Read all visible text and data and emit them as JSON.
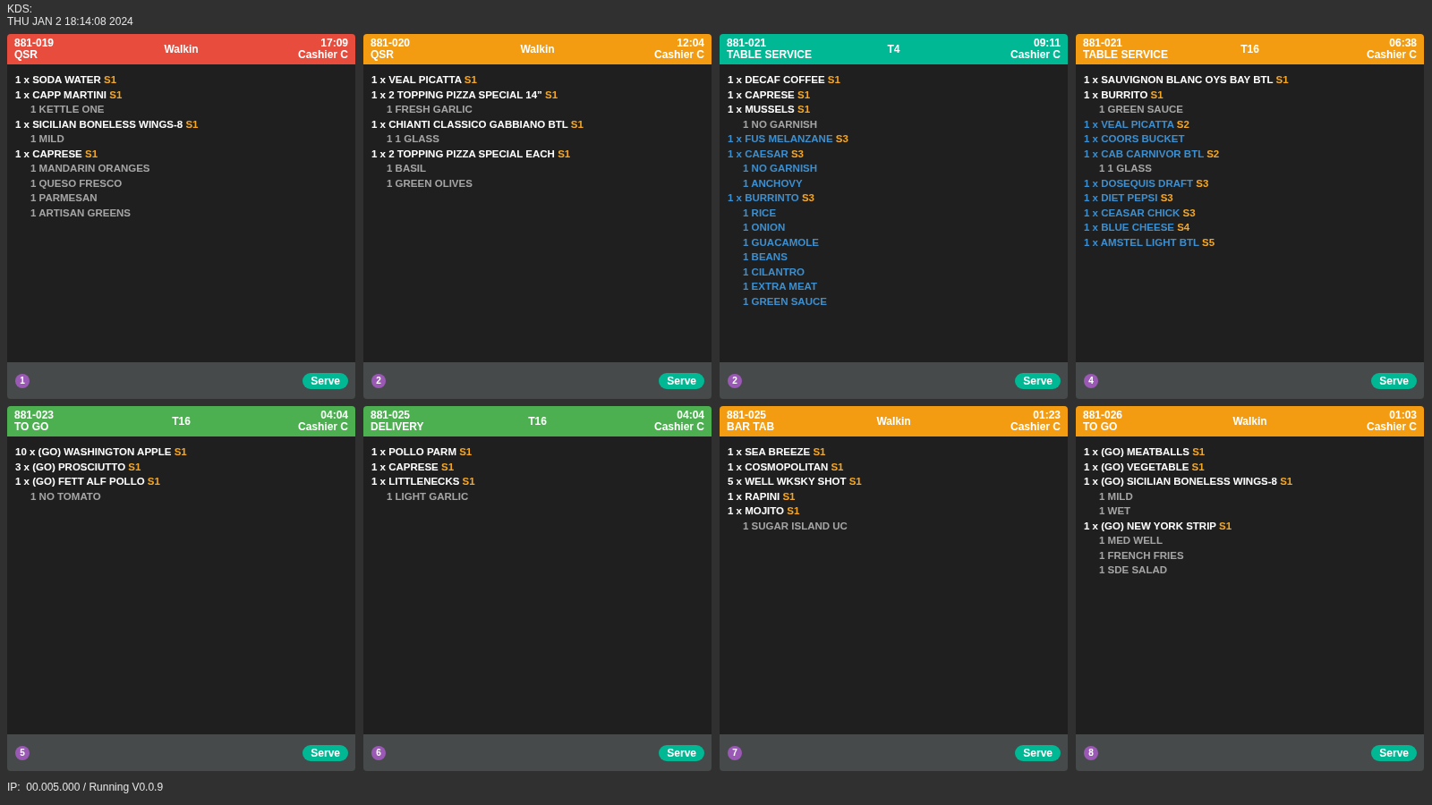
{
  "header": {
    "title": "KDS:",
    "datetime": "THU JAN 2 18:14:08 2024"
  },
  "orders": [
    {
      "number": "881-019",
      "order_type": "QSR",
      "table": "Walkin",
      "time": "17:09",
      "cashier": "Cashier C",
      "color": "#e84c3d",
      "items": [
        {
          "text": "1 x SODA WATER",
          "seat": "S1",
          "color": "#ffffff"
        },
        {
          "text": "1 x CAPP MARTINI",
          "seat": "S1",
          "color": "#ffffff",
          "children": [
            {
              "text": "1 KETTLE ONE",
              "color": "#a5a5a5"
            }
          ]
        },
        {
          "text": "1 x SICILIAN BONELESS WINGS-8",
          "seat": "S1",
          "color": "#ffffff",
          "children": [
            {
              "text": "1 MILD",
              "color": "#a5a5a5"
            }
          ]
        },
        {
          "text": "1 x CAPRESE",
          "seat": "S1",
          "color": "#ffffff",
          "children": [
            {
              "text": "1 MANDARIN ORANGES",
              "color": "#a5a5a5"
            },
            {
              "text": "1 QUESO FRESCO",
              "color": "#a5a5a5"
            },
            {
              "text": "1 PARMESAN",
              "color": "#a5a5a5"
            },
            {
              "text": "1 ARTISAN GREENS",
              "color": "#a5a5a5"
            }
          ]
        }
      ],
      "badge": "1",
      "action": "Serve"
    },
    {
      "number": "881-020",
      "order_type": "QSR",
      "table": "Walkin",
      "time": "12:04",
      "cashier": "Cashier C",
      "color": "#f39c12",
      "items": [
        {
          "text": "1 x VEAL PICATTA",
          "seat": "S1",
          "color": "#ffffff"
        },
        {
          "text": "1 x 2 TOPPING PIZZA SPECIAL 14”",
          "seat": "S1",
          "color": "#ffffff",
          "children": [
            {
              "text": "1 FRESH GARLIC",
              "color": "#a5a5a5"
            }
          ]
        },
        {
          "text": "1 x CHIANTI CLASSICO GABBIANO BTL",
          "seat": "S1",
          "color": "#ffffff",
          "children": [
            {
              "text": "1 1 GLASS",
              "color": "#a5a5a5"
            }
          ]
        },
        {
          "text": "1 x 2 TOPPING PIZZA SPECIAL EACH",
          "seat": "S1",
          "color": "#ffffff",
          "children": [
            {
              "text": "1 BASIL",
              "color": "#a5a5a5"
            },
            {
              "text": "1 GREEN OLIVES",
              "color": "#a5a5a5"
            }
          ]
        }
      ],
      "badge": "2",
      "action": "Serve"
    },
    {
      "number": "881-021",
      "order_type": "TABLE SERVICE",
      "table": "T4",
      "time": "09:11",
      "cashier": "Cashier C",
      "color": "#00b894",
      "items": [
        {
          "text": "1 x DECAF COFFEE",
          "seat": "S1",
          "color": "#ffffff"
        },
        {
          "text": "1 x CAPRESE",
          "seat": "S1",
          "color": "#ffffff"
        },
        {
          "text": "1 x MUSSELS",
          "seat": "S1",
          "color": "#ffffff",
          "children": [
            {
              "text": "1 NO GARNISH",
              "color": "#a5a5a5"
            }
          ]
        },
        {
          "text": "1 x FUS MELANZANE",
          "seat": "S3",
          "color": "#3c8fd0"
        },
        {
          "text": "1 x CAESAR",
          "seat": "S3",
          "color": "#3c8fd0",
          "children": [
            {
              "text": "1 NO GARNISH",
              "color": "#3c8fd0"
            },
            {
              "text": "1 ANCHOVY",
              "color": "#3c8fd0"
            }
          ]
        },
        {
          "text": "1 x BURRINTO",
          "seat": "S3",
          "color": "#3c8fd0",
          "children": [
            {
              "text": "1 RICE",
              "color": "#3c8fd0"
            },
            {
              "text": "1 ONION",
              "color": "#3c8fd0"
            },
            {
              "text": "1 GUACAMOLE",
              "color": "#3c8fd0"
            },
            {
              "text": "1 BEANS",
              "color": "#3c8fd0"
            },
            {
              "text": "1 CILANTRO",
              "color": "#3c8fd0"
            },
            {
              "text": "1 EXTRA MEAT",
              "color": "#3c8fd0"
            },
            {
              "text": "1 GREEN SAUCE",
              "color": "#3c8fd0"
            }
          ]
        }
      ],
      "badge": "2",
      "action": "Serve"
    },
    {
      "number": "881-021",
      "order_type": "TABLE SERVICE",
      "table": "T16",
      "time": "06:38",
      "cashier": "Cashier C",
      "color": "#f39c12",
      "items": [
        {
          "text": "1 x SAUVIGNON BLANC OYS BAY BTL",
          "seat": "S1",
          "color": "#ffffff"
        },
        {
          "text": "1 x BURRITO",
          "seat": "S1",
          "color": "#ffffff",
          "children": [
            {
              "text": "1 GREEN SAUCE",
              "color": "#a5a5a5"
            }
          ]
        },
        {
          "text": "1 x VEAL PICATTA",
          "seat": "S2",
          "color": "#3c8fd0"
        },
        {
          "text": "1 x COORS BUCKET",
          "color": "#3c8fd0"
        },
        {
          "text": "1 x CAB CARNIVOR BTL",
          "seat": "S2",
          "color": "#3c8fd0",
          "children": [
            {
              "text": "1 1 GLASS",
              "color": "#a5a5a5"
            }
          ]
        },
        {
          "text": "1 x DOSEQUIS DRAFT",
          "seat": "S3",
          "color": "#3c8fd0"
        },
        {
          "text": "1 x DIET PEPSI",
          "seat": "S3",
          "color": "#3c8fd0"
        },
        {
          "text": "1 x CEASAR CHICK",
          "seat": "S3",
          "color": "#3c8fd0"
        },
        {
          "text": "1 x BLUE CHEESE",
          "seat": "S4",
          "color": "#3c8fd0"
        },
        {
          "text": "1 x AMSTEL LIGHT BTL",
          "seat": "S5",
          "color": "#3c8fd0"
        }
      ],
      "badge": "4",
      "action": "Serve"
    },
    {
      "number": "881-023",
      "order_type": "TO GO",
      "table": "T16",
      "time": "04:04",
      "cashier": "Cashier C",
      "color": "#4caf50",
      "items": [
        {
          "text": "10 x (GO) WASHINGTON APPLE",
          "seat": "S1",
          "color": "#ffffff"
        },
        {
          "text": "3 x (GO) PROSCIUTTO",
          "seat": "S1",
          "color": "#ffffff"
        },
        {
          "text": "1 x (GO) FETT ALF POLLO",
          "seat": "S1",
          "color": "#ffffff",
          "children": [
            {
              "text": "1 NO TOMATO",
              "color": "#a5a5a5"
            }
          ]
        }
      ],
      "badge": "5",
      "action": "Serve"
    },
    {
      "number": "881-025",
      "order_type": "DELIVERY",
      "table": "T16",
      "time": "04:04",
      "cashier": "Cashier C",
      "color": "#4caf50",
      "items": [
        {
          "text": "1 x POLLO PARM",
          "seat": "S1",
          "color": "#ffffff"
        },
        {
          "text": "1 x CAPRESE",
          "seat": "S1",
          "color": "#ffffff"
        },
        {
          "text": "1 x LITTLENECKS",
          "seat": "S1",
          "color": "#ffffff",
          "children": [
            {
              "text": "1 LIGHT GARLIC",
              "color": "#a5a5a5"
            }
          ]
        }
      ],
      "badge": "6",
      "action": "Serve"
    },
    {
      "number": "881-025",
      "order_type": "BAR TAB",
      "table": "Walkin",
      "time": "01:23",
      "cashier": "Cashier C",
      "color": "#f39c12",
      "items": [
        {
          "text": "1 x SEA BREEZE",
          "seat": "S1",
          "color": "#ffffff"
        },
        {
          "text": "1 x COSMOPOLITAN",
          "seat": "S1",
          "color": "#ffffff"
        },
        {
          "text": "5 x WELL WKSKY SHOT",
          "seat": "S1",
          "color": "#ffffff"
        },
        {
          "text": "1 x RAPINI",
          "seat": "S1",
          "color": "#ffffff"
        },
        {
          "text": "1 x MOJITO",
          "seat": "S1",
          "color": "#ffffff",
          "children": [
            {
              "text": "1 SUGAR ISLAND UC",
              "color": "#a5a5a5"
            }
          ]
        }
      ],
      "badge": "7",
      "action": "Serve"
    },
    {
      "number": "881-026",
      "order_type": "TO GO",
      "table": "Walkin",
      "time": "01:03",
      "cashier": "Cashier C",
      "color": "#f39c12",
      "items": [
        {
          "text": "1 x (GO) MEATBALLS",
          "seat": "S1",
          "color": "#ffffff"
        },
        {
          "text": "1 x (GO) VEGETABLE",
          "seat": "S1",
          "color": "#ffffff"
        },
        {
          "text": "1 x (GO) SICILIAN BONELESS WINGS-8",
          "seat": "S1",
          "color": "#ffffff",
          "children": [
            {
              "text": "1 MILD",
              "color": "#a5a5a5"
            },
            {
              "text": "1 WET",
              "color": "#a5a5a5"
            }
          ]
        },
        {
          "text": "1 x (GO) NEW YORK STRIP",
          "seat": "S1",
          "color": "#ffffff",
          "children": [
            {
              "text": "1 MED WELL",
              "color": "#a5a5a5"
            },
            {
              "text": "1 FRENCH FRIES",
              "color": "#a5a5a5"
            },
            {
              "text": "1 SDE SALAD",
              "color": "#a5a5a5"
            }
          ]
        }
      ],
      "badge": "8",
      "action": "Serve"
    }
  ],
  "status_bar": "IP:  00.005.000 / Running V0.0.9"
}
